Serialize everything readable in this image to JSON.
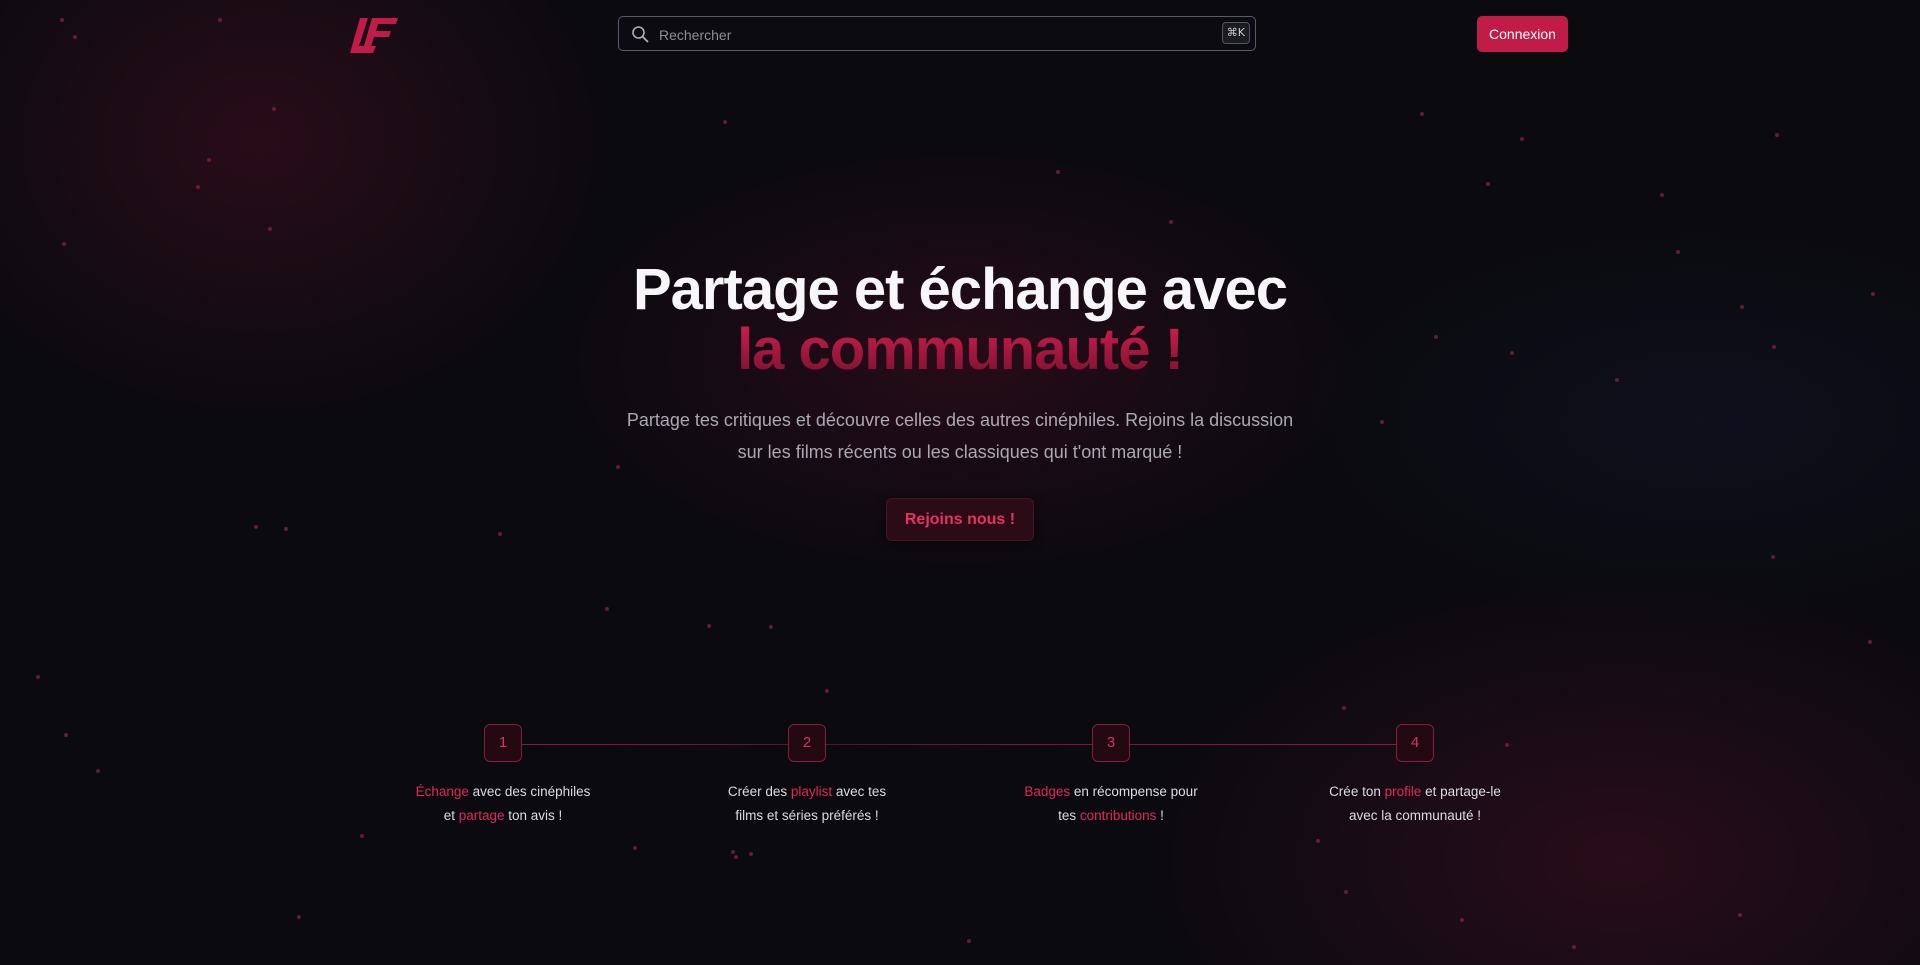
{
  "header": {
    "logo_alt": "LF",
    "search": {
      "placeholder": "Rechercher",
      "value": "",
      "shortcut": "⌘K"
    },
    "login_label": "Connexion"
  },
  "hero": {
    "title_line1": "Partage et échange avec",
    "title_line2": "la communauté !",
    "subtitle_line1": "Partage tes critiques et découvre celles des autres cinéphiles. Rejoins la discussion",
    "subtitle_line2": "sur les films récents ou les classiques qui t'ont marqué !",
    "cta_label": "Rejoins nous !"
  },
  "steps": [
    {
      "number": "1",
      "line1": [
        {
          "t": "Échange",
          "hl": true
        },
        {
          "t": " avec des cinéphiles",
          "hl": false
        }
      ],
      "line2": [
        {
          "t": "et ",
          "hl": false
        },
        {
          "t": "partage",
          "hl": true
        },
        {
          "t": " ton avis !",
          "hl": false
        }
      ]
    },
    {
      "number": "2",
      "line1": [
        {
          "t": "Créer des ",
          "hl": false
        },
        {
          "t": "playlist",
          "hl": true
        },
        {
          "t": " avec tes",
          "hl": false
        }
      ],
      "line2": [
        {
          "t": "films et séries préférés !",
          "hl": false
        }
      ]
    },
    {
      "number": "3",
      "line1": [
        {
          "t": "Badges",
          "hl": true
        },
        {
          "t": " en récompense pour",
          "hl": false
        }
      ],
      "line2": [
        {
          "t": "tes ",
          "hl": false
        },
        {
          "t": "contributions",
          "hl": true
        },
        {
          "t": " !",
          "hl": false
        }
      ]
    },
    {
      "number": "4",
      "line1": [
        {
          "t": "Crée ton ",
          "hl": false
        },
        {
          "t": "profile",
          "hl": true
        },
        {
          "t": " et partage-le",
          "hl": false
        }
      ],
      "line2": [
        {
          "t": "avec la communauté !",
          "hl": false
        }
      ]
    }
  ],
  "colors": {
    "accent": "#c01c47",
    "highlight": "#e02a58",
    "background": "#0a0a0f"
  },
  "icons": {
    "logo": "lf-logo",
    "search": "search-icon"
  }
}
